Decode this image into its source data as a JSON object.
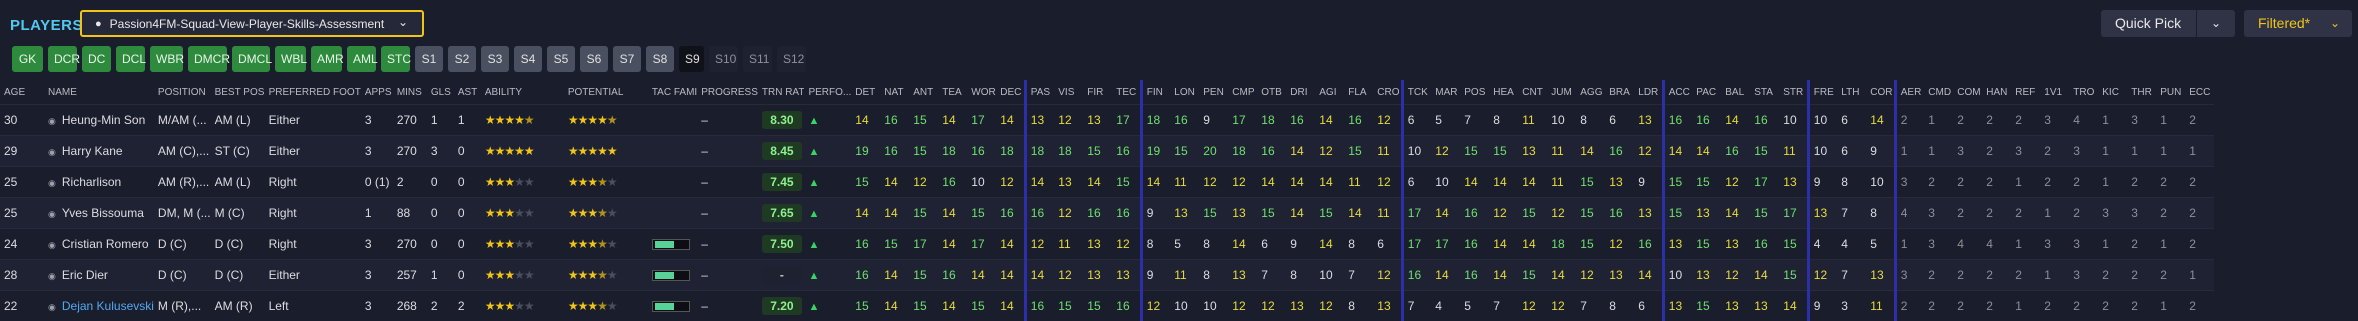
{
  "header": {
    "title": "PLAYERS",
    "view_name": "Passion4FM-Squad-View-Player-Skills-Assessment",
    "quick_pick": "Quick Pick",
    "filtered": "Filtered*"
  },
  "positions": [
    {
      "label": "GK",
      "state": "active"
    },
    {
      "label": "DCR",
      "state": "active"
    },
    {
      "label": "DC",
      "state": "active"
    },
    {
      "label": "DCL",
      "state": "active"
    },
    {
      "label": "WBR",
      "state": "active"
    },
    {
      "label": "DMCR",
      "state": "active"
    },
    {
      "label": "DMCL",
      "state": "active"
    },
    {
      "label": "WBL",
      "state": "active"
    },
    {
      "label": "AMR",
      "state": "active"
    },
    {
      "label": "AML",
      "state": "active"
    },
    {
      "label": "STC",
      "state": "active"
    },
    {
      "label": "S1",
      "state": "sub"
    },
    {
      "label": "S2",
      "state": "sub"
    },
    {
      "label": "S3",
      "state": "sub"
    },
    {
      "label": "S4",
      "state": "sub"
    },
    {
      "label": "S5",
      "state": "sub"
    },
    {
      "label": "S6",
      "state": "sub"
    },
    {
      "label": "S7",
      "state": "sub"
    },
    {
      "label": "S8",
      "state": "sub"
    },
    {
      "label": "S9",
      "state": "sel"
    },
    {
      "label": "S10",
      "state": "off"
    },
    {
      "label": "S11",
      "state": "off"
    },
    {
      "label": "S12",
      "state": "off"
    }
  ],
  "columns": [
    "AGE",
    "NAME",
    "POSITION",
    "BEST POS",
    "PREFERRED FOOT",
    "APPS",
    "MINS",
    "GLS",
    "AST",
    "ABILITY",
    "POTENTIAL",
    "TAC FAMI",
    "PROGRESS",
    "TRN RAT",
    "PERFO...",
    "DET",
    "NAT",
    "ANT",
    "TEA",
    "WOR",
    "DEC",
    "PAS",
    "VIS",
    "FIR",
    "TEC",
    "FIN",
    "LON",
    "PEN",
    "CMP",
    "OTB",
    "DRI",
    "AGI",
    "FLA",
    "CRO",
    "TCK",
    "MAR",
    "POS",
    "HEA",
    "CNT",
    "JUM",
    "AGG",
    "BRA",
    "LDR",
    "ACC",
    "PAC",
    "BAL",
    "STA",
    "STR",
    "FRE",
    "LTH",
    "COR",
    "AER",
    "CMD",
    "COM",
    "HAN",
    "REF",
    "1V1",
    "TRO",
    "KIC",
    "THR",
    "PUN",
    "ECC"
  ],
  "players": [
    {
      "age": "30",
      "name": "Heung-Min Son",
      "position": "M/AM (...",
      "best_pos": "AM (L)",
      "foot": "Either",
      "apps": "3",
      "mins": "270",
      "gls": "1",
      "ast": "1",
      "ability": 4.5,
      "potential": 4.5,
      "tac": 0.0,
      "progress": "–",
      "trn": "8.30",
      "perf": "▲",
      "attrs": [
        "14",
        "16",
        "15",
        "14",
        "17",
        "14",
        "13",
        "12",
        "13",
        "17",
        "18",
        "16",
        "9",
        "17",
        "18",
        "16",
        "14",
        "16",
        "12",
        "6",
        "5",
        "7",
        "8",
        "11",
        "10",
        "8",
        "6",
        "13",
        "16",
        "16",
        "14",
        "16",
        "10",
        "10",
        "6",
        "14",
        "2",
        "1",
        "2",
        "2",
        "2",
        "3",
        "4",
        "1",
        "3",
        "1",
        "2"
      ]
    },
    {
      "age": "29",
      "name": "Harry Kane",
      "position": "AM (C),...",
      "best_pos": "ST (C)",
      "foot": "Either",
      "apps": "3",
      "mins": "270",
      "gls": "3",
      "ast": "0",
      "ability": 5,
      "potential": 5,
      "tac": 0.0,
      "progress": "–",
      "trn": "8.45",
      "perf": "▲",
      "attrs": [
        "19",
        "16",
        "15",
        "18",
        "16",
        "18",
        "18",
        "18",
        "15",
        "16",
        "19",
        "15",
        "20",
        "18",
        "16",
        "14",
        "12",
        "15",
        "11",
        "10",
        "12",
        "15",
        "15",
        "13",
        "11",
        "14",
        "16",
        "12",
        "14",
        "14",
        "16",
        "15",
        "11",
        "10",
        "6",
        "9",
        "1",
        "1",
        "3",
        "2",
        "3",
        "2",
        "3",
        "1",
        "1",
        "1",
        "1"
      ]
    },
    {
      "age": "25",
      "name": "Richarlison",
      "position": "AM (R),...",
      "best_pos": "AM (L)",
      "foot": "Right",
      "apps": "0 (1)",
      "mins": "2",
      "gls": "0",
      "ast": "0",
      "ability": 3,
      "potential": 3.5,
      "tac": 0.0,
      "progress": "–",
      "trn": "7.45",
      "perf": "▲",
      "attrs": [
        "15",
        "14",
        "12",
        "16",
        "10",
        "12",
        "14",
        "13",
        "14",
        "15",
        "14",
        "11",
        "12",
        "12",
        "14",
        "14",
        "14",
        "11",
        "12",
        "6",
        "10",
        "14",
        "14",
        "14",
        "11",
        "15",
        "13",
        "9",
        "15",
        "15",
        "12",
        "17",
        "13",
        "9",
        "8",
        "10",
        "3",
        "2",
        "2",
        "2",
        "1",
        "2",
        "2",
        "1",
        "2",
        "2",
        "2"
      ]
    },
    {
      "age": "25",
      "name": "Yves Bissouma",
      "position": "DM, M (...",
      "best_pos": "M (C)",
      "foot": "Right",
      "apps": "1",
      "mins": "88",
      "gls": "0",
      "ast": "0",
      "ability": 3,
      "potential": 3.5,
      "tac": 0.0,
      "progress": "–",
      "trn": "7.65",
      "perf": "▲",
      "attrs": [
        "14",
        "14",
        "15",
        "14",
        "15",
        "16",
        "16",
        "12",
        "16",
        "16",
        "9",
        "13",
        "15",
        "13",
        "15",
        "14",
        "15",
        "14",
        "11",
        "17",
        "14",
        "16",
        "12",
        "15",
        "12",
        "15",
        "16",
        "13",
        "15",
        "13",
        "14",
        "15",
        "17",
        "13",
        "7",
        "8",
        "4",
        "3",
        "2",
        "2",
        "2",
        "1",
        "2",
        "3",
        "3",
        "2",
        "2"
      ]
    },
    {
      "age": "24",
      "name": "Cristian Romero",
      "position": "D (C)",
      "best_pos": "D (C)",
      "foot": "Right",
      "apps": "3",
      "mins": "270",
      "gls": "0",
      "ast": "0",
      "ability": 3,
      "potential": 3.5,
      "tac": 0.6,
      "progress": "–",
      "trn": "7.50",
      "perf": "▲",
      "attrs": [
        "16",
        "15",
        "17",
        "14",
        "17",
        "14",
        "12",
        "11",
        "13",
        "12",
        "8",
        "5",
        "8",
        "14",
        "6",
        "9",
        "14",
        "8",
        "6",
        "17",
        "17",
        "16",
        "14",
        "14",
        "18",
        "15",
        "12",
        "16",
        "13",
        "15",
        "13",
        "16",
        "15",
        "4",
        "4",
        "5",
        "1",
        "3",
        "4",
        "4",
        "1",
        "3",
        "3",
        "1",
        "2",
        "1",
        "2"
      ]
    },
    {
      "age": "28",
      "name": "Eric Dier",
      "position": "D (C)",
      "best_pos": "D (C)",
      "foot": "Either",
      "apps": "3",
      "mins": "257",
      "gls": "1",
      "ast": "0",
      "ability": 3,
      "potential": 3.5,
      "tac": 0.6,
      "progress": "–",
      "trn": "-",
      "perf": "▲",
      "attrs": [
        "16",
        "14",
        "15",
        "16",
        "14",
        "14",
        "14",
        "12",
        "13",
        "13",
        "9",
        "11",
        "8",
        "13",
        "7",
        "8",
        "10",
        "7",
        "12",
        "16",
        "14",
        "16",
        "14",
        "15",
        "14",
        "12",
        "13",
        "14",
        "10",
        "13",
        "12",
        "14",
        "15",
        "12",
        "7",
        "13",
        "3",
        "2",
        "2",
        "2",
        "2",
        "1",
        "3",
        "2",
        "2",
        "2",
        "1"
      ]
    },
    {
      "age": "22",
      "name": "Dejan Kulusevski",
      "position": "M (R),...",
      "best_pos": "AM (R)",
      "foot": "Left",
      "apps": "3",
      "mins": "268",
      "gls": "2",
      "ast": "2",
      "ability": 3,
      "potential": 3.5,
      "tac": 0.6,
      "progress": "–",
      "trn": "7.20",
      "perf": "▲",
      "attrs": [
        "15",
        "14",
        "15",
        "14",
        "15",
        "14",
        "16",
        "15",
        "15",
        "16",
        "12",
        "10",
        "10",
        "12",
        "12",
        "13",
        "12",
        "8",
        "13",
        "7",
        "4",
        "5",
        "7",
        "12",
        "12",
        "7",
        "8",
        "6",
        "13",
        "15",
        "13",
        "13",
        "14",
        "9",
        "3",
        "11",
        "2",
        "2",
        "2",
        "2",
        "1",
        "2",
        "2",
        "2",
        "2",
        "1",
        "2"
      ]
    }
  ],
  "colors": {
    "accent": "#52c8f0",
    "highlight": "#f0c419",
    "green_btn": "#2e8b3e",
    "divider": "#2d2fa8"
  }
}
